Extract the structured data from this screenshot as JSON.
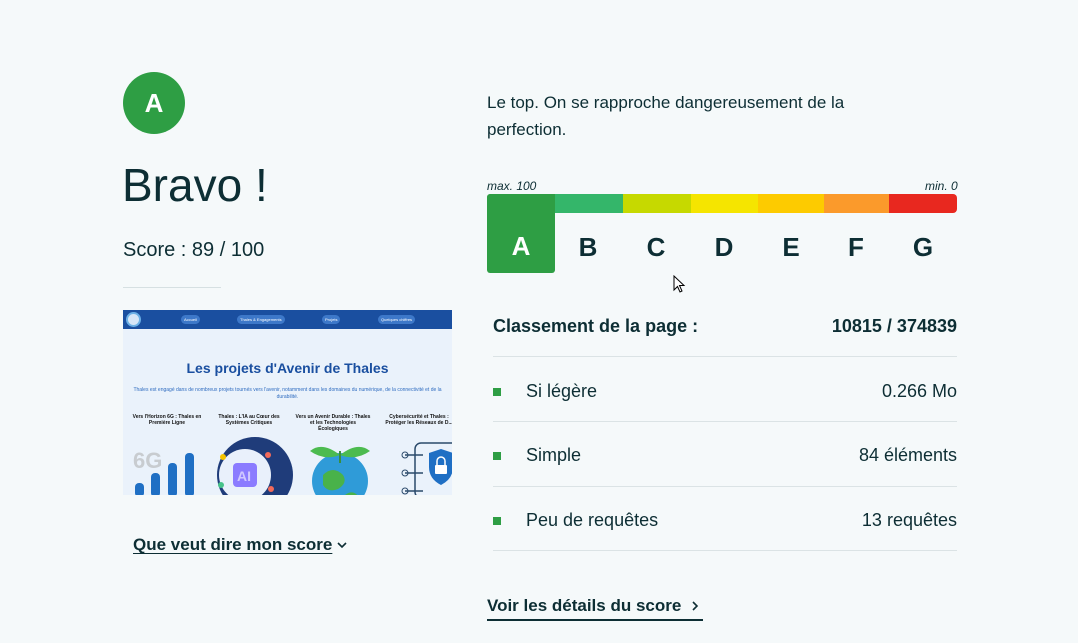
{
  "result": {
    "grade": "A",
    "headline": "Bravo !",
    "score_text": "Score : 89 / 100",
    "description": "Le top. On se rapproche dangereusement de la perfection."
  },
  "thumbnail": {
    "nav_items": [
      "Accueil",
      "Thales & Engagements",
      "Projets",
      "Quelques chiffres"
    ],
    "title": "Les projets d'Avenir de Thales",
    "subtitle": "Thales est engagé dans de nombreux projets tournés vers l'avenir, notamment dans les domaines du numérique, de la connectivité et de la durabilité.",
    "cards": [
      "Vers l'Horizon 6G : Thales en Première Ligne",
      "Thales : L'IA au Cœur des Systèmes Critiques",
      "Vers un Avenir Durable : Thales et les Technologies Écologiques",
      "Cybersécurité et Thales : Protéger les Réseaux de D..."
    ],
    "card_6g_text": "6G",
    "card_ai_text": "AI"
  },
  "links": {
    "score_meaning": "Que veut dire mon score",
    "score_details": "Voir les détails du score"
  },
  "scale": {
    "max_label": "max. 100",
    "min_label": "min. 0",
    "grades": [
      "A",
      "B",
      "C",
      "D",
      "E",
      "F",
      "G"
    ],
    "colors": [
      "#2e9e44",
      "#34b66a",
      "#c6d900",
      "#f5e500",
      "#fdcb00",
      "#fb9a2b",
      "#e8281f"
    ],
    "active_index": 0
  },
  "ranking": {
    "label": "Classement de la page :",
    "value": "10815 / 374839"
  },
  "metrics": [
    {
      "label": "Si légère",
      "value": "0.266 Mo"
    },
    {
      "label": "Simple",
      "value": "84 éléments"
    },
    {
      "label": "Peu de requêtes",
      "value": "13 requêtes"
    }
  ]
}
